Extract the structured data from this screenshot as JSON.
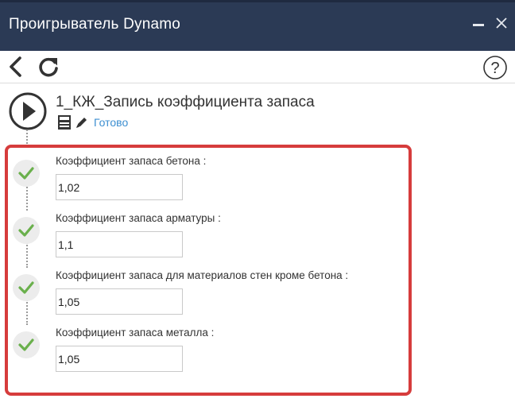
{
  "window": {
    "title": "Проигрыватель Dynamo",
    "minimize_glyph": "—",
    "close_glyph": "✕",
    "titlebar_color": "#2b3a55"
  },
  "toolbar": {
    "back_icon": "chevron-left-icon",
    "refresh_icon": "refresh-icon",
    "help_icon": "help-icon",
    "help_glyph": "?"
  },
  "script": {
    "name": "1_КЖ_Запись коэффициента запаса",
    "status": "Готово",
    "status_color": "#3d8fd1",
    "play_icon": "play-icon",
    "save_icon": "save-icon",
    "edit_icon": "pencil-icon"
  },
  "inputs": [
    {
      "label": "Коэффициент запаса бетона :",
      "value": "1,02"
    },
    {
      "label": "Коэффициент запаса арматуры :",
      "value": "1,1"
    },
    {
      "label": "Коэффициент запаса для материалов стен кроме бетона :",
      "value": "1,05"
    },
    {
      "label": "Коэффициент запаса металла :",
      "value": "1,05"
    }
  ],
  "colors": {
    "highlight": "#d63c3c",
    "check": "#6ab04c"
  }
}
